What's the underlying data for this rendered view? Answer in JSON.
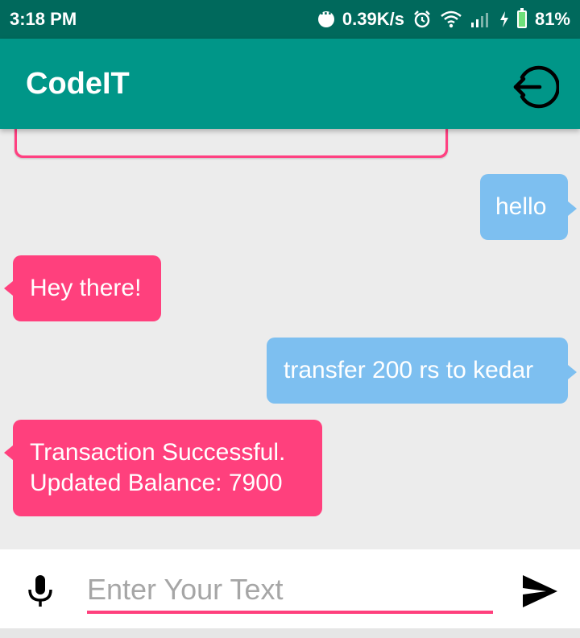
{
  "status_bar": {
    "time": "3:18 PM",
    "net_speed": "0.39K/s",
    "battery": "81%",
    "icons": [
      "notification-dots-icon",
      "alarm-icon",
      "wifi-icon",
      "signal-icon",
      "charging-icon",
      "battery-icon"
    ]
  },
  "app_bar": {
    "title": "CodeIT",
    "action_icon": "logout-icon"
  },
  "messages": [
    {
      "sender": "user",
      "text": "hello"
    },
    {
      "sender": "bot",
      "text": "Hey there!"
    },
    {
      "sender": "user",
      "text": "transfer 200 rs to kedar"
    },
    {
      "sender": "bot",
      "lines": [
        "Transaction Successful.",
        "Updated Balance: 7900"
      ]
    }
  ],
  "input": {
    "placeholder": "Enter Your Text",
    "value": "",
    "mic_icon": "microphone-icon",
    "send_icon": "send-icon"
  },
  "colors": {
    "status_bar": "#00695c",
    "app_bar": "#009688",
    "user_bubble": "#7dbff0",
    "bot_bubble": "#ff407d",
    "background": "#ececec",
    "accent": "#ff407d"
  }
}
